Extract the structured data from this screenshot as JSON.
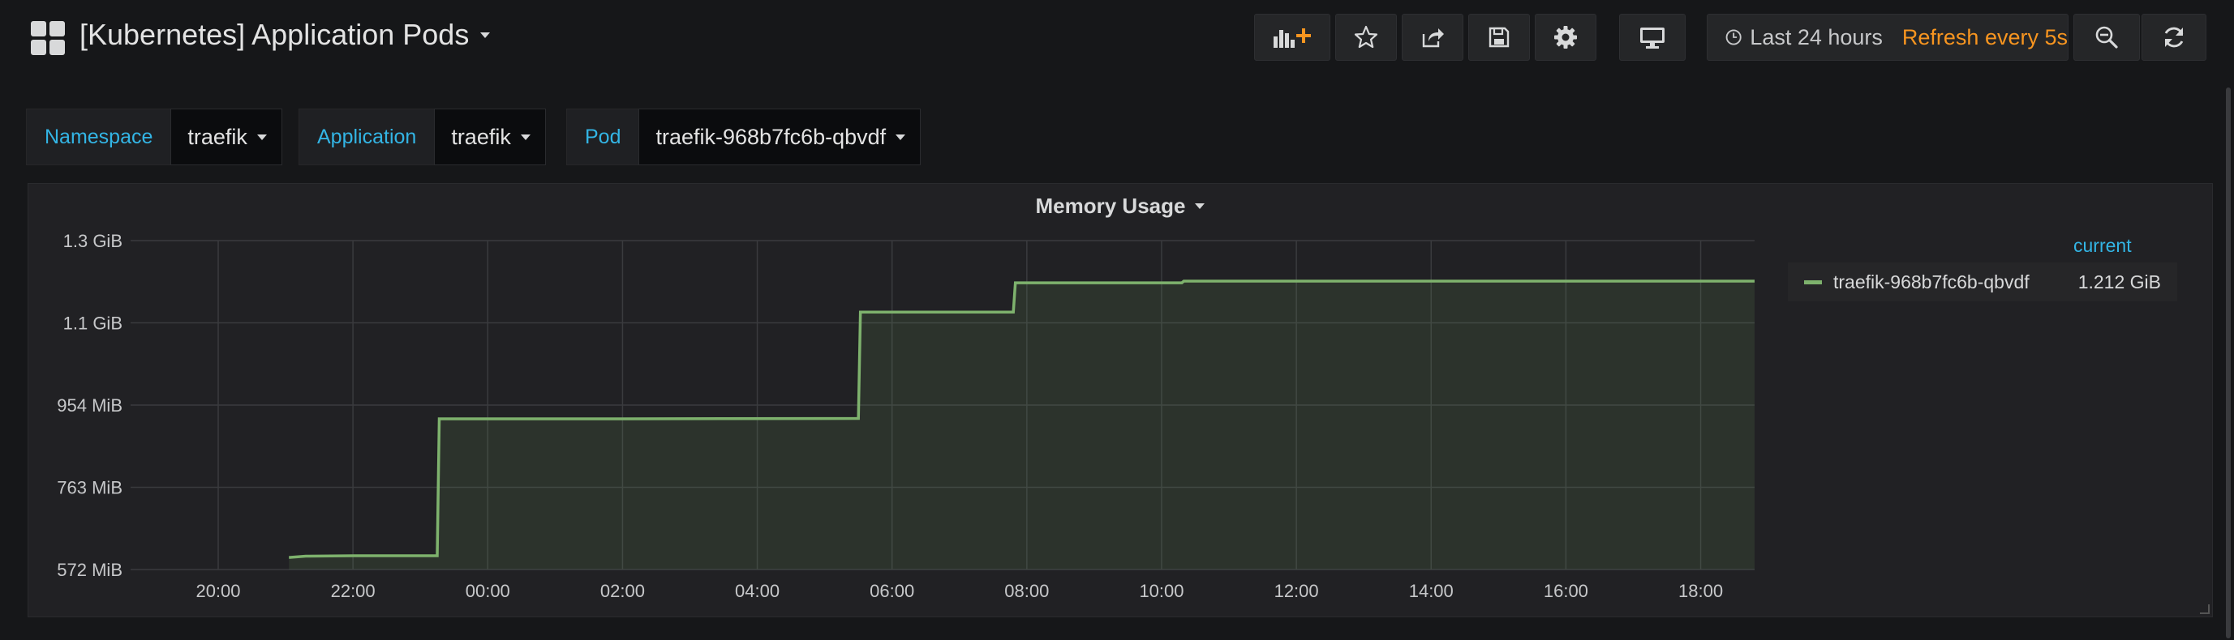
{
  "header": {
    "title": "[Kubernetes] Application Pods",
    "buttons": [
      {
        "name": "add-panel-button",
        "icon": "add-panel-icon"
      },
      {
        "name": "star-button",
        "icon": "star-icon"
      },
      {
        "name": "share-button",
        "icon": "share-icon"
      },
      {
        "name": "save-button",
        "icon": "save-icon"
      },
      {
        "name": "settings-button",
        "icon": "gear-icon"
      },
      {
        "name": "tv-mode-button",
        "icon": "monitor-icon"
      }
    ],
    "time_range": "Last 24 hours",
    "refresh": "Refresh every 5s",
    "accent_color": "#f79520"
  },
  "variables": {
    "namespace": {
      "label": "Namespace",
      "value": "traefik"
    },
    "application": {
      "label": "Application",
      "value": "traefik"
    },
    "pod": {
      "label": "Pod",
      "value": "traefik-968b7fc6b-qbvdf"
    }
  },
  "panel": {
    "title": "Memory Usage",
    "legend_header": "current"
  },
  "chart_data": {
    "type": "line",
    "title": "Memory Usage",
    "fill": true,
    "grid": true,
    "legend_placement": "right",
    "line_color": "#7eb26d",
    "y_ticks": [
      {
        "value": 572,
        "label": "572 MiB"
      },
      {
        "value": 763,
        "label": "763 MiB"
      },
      {
        "value": 954,
        "label": "954 MiB"
      },
      {
        "value": 1145,
        "label": "1.1 GiB"
      },
      {
        "value": 1336,
        "label": "1.3 GiB"
      }
    ],
    "ylim_mib": [
      572,
      1336
    ],
    "x_ticks": [
      "20:00",
      "22:00",
      "00:00",
      "02:00",
      "04:00",
      "06:00",
      "08:00",
      "10:00",
      "12:00",
      "14:00",
      "16:00",
      "18:00"
    ],
    "xlim_hours_from_first_tick": [
      -1.3,
      22.8
    ],
    "series": [
      {
        "name": "traefik-968b7fc6b-qbvdf",
        "current": "1.212 GiB",
        "points_hours_mib": [
          [
            1.05,
            600
          ],
          [
            1.3,
            603
          ],
          [
            2,
            604
          ],
          [
            3.25,
            604
          ],
          [
            3.28,
            922
          ],
          [
            6,
            922
          ],
          [
            9.5,
            923
          ],
          [
            9.53,
            1170
          ],
          [
            11.8,
            1170
          ],
          [
            11.83,
            1238
          ],
          [
            14.3,
            1238
          ],
          [
            14.33,
            1242
          ],
          [
            22.8,
            1242
          ]
        ]
      }
    ]
  }
}
